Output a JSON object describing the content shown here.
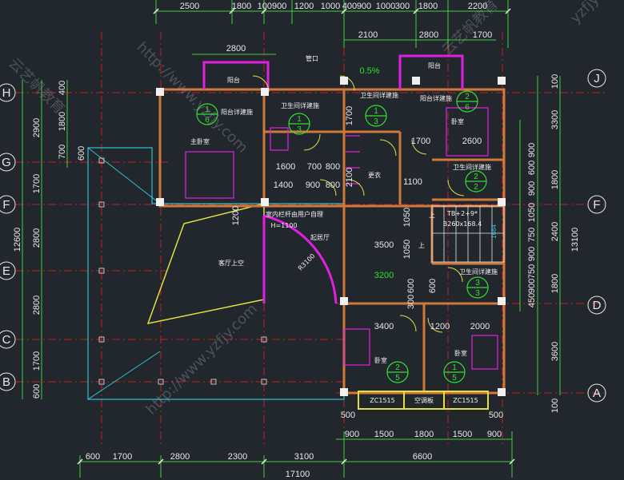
{
  "top_dims_row1": [
    "2500",
    "1800",
    "100900",
    "1200",
    "1000",
    "400",
    "900",
    "1000",
    "300",
    "1800",
    "2200"
  ],
  "top_dims_row2": [
    "2100",
    "2800",
    "1700"
  ],
  "top_dims_row3": [
    "2800",
    "0.5%"
  ],
  "bottom_dims_row1": [
    "900",
    "1500",
    "1800",
    "1500",
    "900"
  ],
  "bottom_dims_row2": [
    "600",
    "1700",
    "2800",
    "2300",
    "3100",
    "6600"
  ],
  "bottom_total": "17100",
  "bottom_small": [
    "500",
    "500"
  ],
  "left_outer_dims": [
    "2900",
    "1700",
    "2800",
    "2800",
    "1700",
    "600"
  ],
  "left_total": "12600",
  "left_inner_dims": [
    "400",
    "1800",
    "700",
    "600"
  ],
  "right_dims_col1": [
    "900",
    "600",
    "900",
    "1050",
    "750",
    "900",
    "750",
    "900",
    "450",
    "600"
  ],
  "right_dims_col2": [
    "3300",
    "1800",
    "2400",
    "1800",
    "3600"
  ],
  "right_total": "13100",
  "right_small": [
    "100",
    "100"
  ],
  "axes_left": [
    "H",
    "G",
    "F",
    "E",
    "C",
    "B"
  ],
  "axes_right": [
    "J",
    "F",
    "D",
    "A"
  ],
  "rooms": {
    "balcony_left": "阳台",
    "balcony_right": "阳台",
    "balcony_detail_left": "阳台详建施",
    "balcony_detail_right": "阳台详建施",
    "bath_detail_1": "卫生间详建施",
    "bath_detail_2": "卫生间详建施",
    "bath_detail_3": "卫生间详建施",
    "bath_detail_4": "卫生间详建施",
    "master_bedroom": "主卧室",
    "bedroom_ne": "卧室",
    "bedroom_s1": "卧室",
    "bedroom_s2": "卧室",
    "closet": "更衣",
    "living_void": "客厅上空",
    "railing": "室内栏杆由用户自理",
    "railing_h": "H=1100",
    "stair": "TB+2+9*",
    "stair2": "B260x168.4",
    "rise": "起居厅",
    "radius": "R3100",
    "ac_board": "空调板",
    "window1": "ZC1515",
    "window2": "ZC1515",
    "drain": "管口",
    "up1": "上",
    "up2": "上"
  },
  "detail_marks": [
    {
      "top": "1",
      "bottom": "6"
    },
    {
      "top": "1",
      "bottom": "3"
    },
    {
      "top": "2",
      "bottom": "6"
    },
    {
      "top": "1",
      "bottom": "3"
    },
    {
      "top": "2",
      "bottom": "2"
    },
    {
      "top": "3",
      "bottom": "3"
    },
    {
      "top": "2",
      "bottom": "5"
    },
    {
      "top": "1",
      "bottom": "5"
    }
  ],
  "inner_dims": [
    "1600",
    "700",
    "800",
    "1400",
    "900",
    "800",
    "1700",
    "2600",
    "2100",
    "1100",
    "1200",
    "3500",
    "3200",
    "3400",
    "1200",
    "2000",
    "1050",
    "1050",
    "600",
    "300",
    "600",
    "1700",
    "1684",
    "2100"
  ],
  "watermarks": [
    "http://www.yzfjy.com",
    "云艺帆教育",
    "yzfjy",
    "http://www.yzfjy.com",
    "云艺帆教育"
  ],
  "colors": {
    "background": "#22262d",
    "wall": "#d07a3a",
    "magenta": "#e020e0",
    "green": "#30e030",
    "yellow": "#e0e040",
    "cyan": "#30c0d0",
    "red_axis": "#d02020",
    "dim_line": "#40d040"
  }
}
